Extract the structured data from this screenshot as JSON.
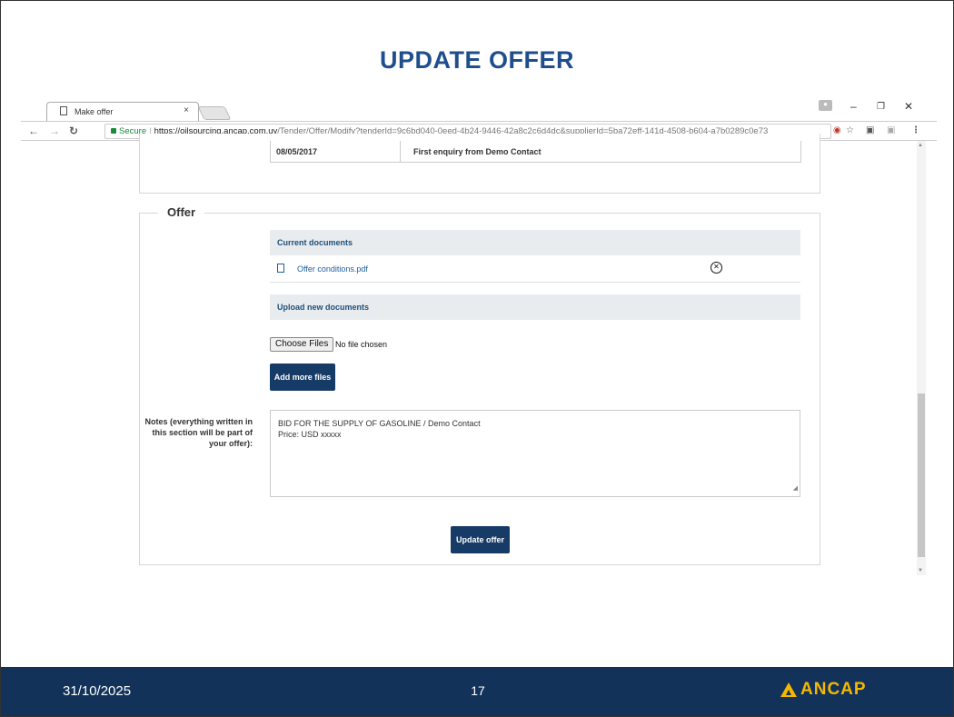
{
  "slide": {
    "title": "UPDATE OFFER",
    "footer_date": "31/10/2025",
    "page_number": "17",
    "logo_text": "ANCAP",
    "brand_color": "#12325a",
    "accent_color": "#f5b800"
  },
  "browser": {
    "tab_title": "Make offer",
    "tab_close_glyph": "×",
    "url_secure_label": "Secure",
    "url_host": "https://oilsourcing.ancap.com.uy",
    "url_path": "/Tender/Offer/Modify?tenderId=9c6bd040-0eed-4b24-9446-42a8c2c6d4dc&supplierId=5ba72eff-141d-4508-b604-a7b0289c0e73"
  },
  "history": {
    "date": "08/05/2017",
    "event": "First enquiry from Demo Contact"
  },
  "offer": {
    "legend": "Offer",
    "current_documents_header": "Current documents",
    "documents": [
      {
        "name": "Offer conditions.pdf"
      }
    ],
    "upload_header": "Upload new documents",
    "choose_files_label": "Choose Files",
    "no_file_text": "No file chosen",
    "add_more_files_label": "Add more files",
    "notes_label": "Notes (everything written in this section will be part of your offer):",
    "notes_lines": [
      "BID FOR THE SUPPLY OF GASOLINE / Demo Contact",
      "Price: USD xxxxx"
    ],
    "update_button_label": "Update offer"
  }
}
